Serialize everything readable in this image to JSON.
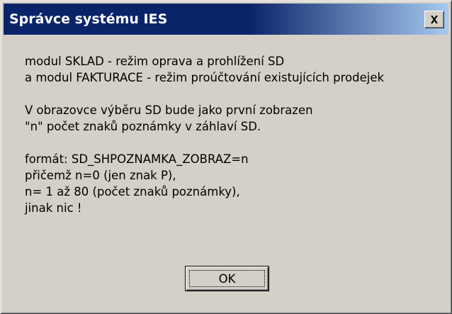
{
  "window": {
    "title": "Správce systému IES",
    "close_glyph": "✕"
  },
  "message": {
    "lines": [
      "modul SKLAD - režim oprava a prohlížení SD",
      "a modul FAKTURACE - režim proúčtování existujících prodejek",
      "",
      "V obrazovce výběru SD bude jako první zobrazen",
      "\"n\" počet znaků poznámky v záhlaví SD.",
      "",
      "formát: SD_SHPOZNAMKA_ZOBRAZ=n",
      "přičemž n=0 (jen znak P),",
      "n= 1 až 80 (počet znaků poznámky),",
      "jinak nic !"
    ]
  },
  "buttons": {
    "ok_label": "OK"
  },
  "colors": {
    "titlebar_start": "#0a246a",
    "titlebar_end": "#a6caf0",
    "face": "#d4d0c8"
  }
}
